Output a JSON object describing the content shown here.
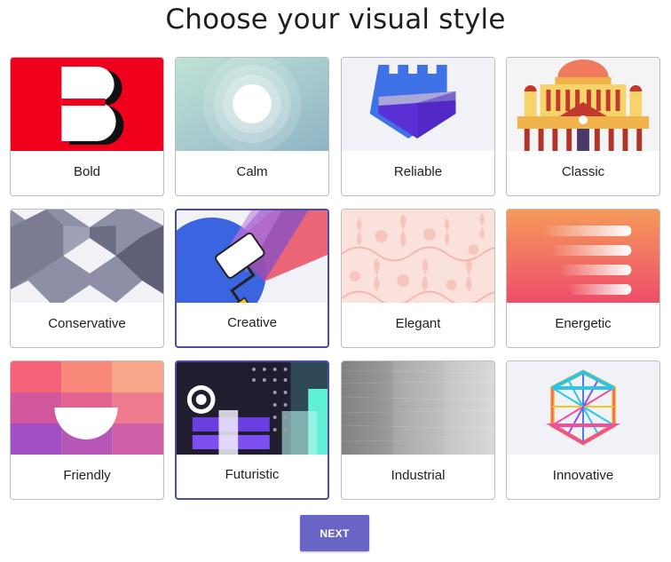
{
  "page": {
    "title": "Choose your visual style"
  },
  "styles": [
    {
      "label": "Bold",
      "selected": false,
      "icon": "bold-b-icon"
    },
    {
      "label": "Calm",
      "selected": false,
      "icon": "concentric-circles-icon"
    },
    {
      "label": "Reliable",
      "selected": false,
      "icon": "castle-shield-icon"
    },
    {
      "label": "Classic",
      "selected": false,
      "icon": "domed-building-icon"
    },
    {
      "label": "Conservative",
      "selected": false,
      "icon": "geometric-pattern-icon"
    },
    {
      "label": "Creative",
      "selected": true,
      "icon": "paint-roller-icon"
    },
    {
      "label": "Elegant",
      "selected": false,
      "icon": "damask-pattern-icon"
    },
    {
      "label": "Energetic",
      "selected": false,
      "icon": "speed-lines-icon"
    },
    {
      "label": "Friendly",
      "selected": false,
      "icon": "semicircle-mosaic-icon"
    },
    {
      "label": "Futuristic",
      "selected": true,
      "icon": "retro-tech-icon"
    },
    {
      "label": "Industrial",
      "selected": false,
      "icon": "brushed-metal-icon"
    },
    {
      "label": "Innovative",
      "selected": false,
      "icon": "rainbow-hexagon-icon"
    }
  ],
  "actions": {
    "next_label": "NEXT"
  },
  "colors": {
    "accent": "#6a64c7",
    "selected_border": "#4b4aa8"
  }
}
